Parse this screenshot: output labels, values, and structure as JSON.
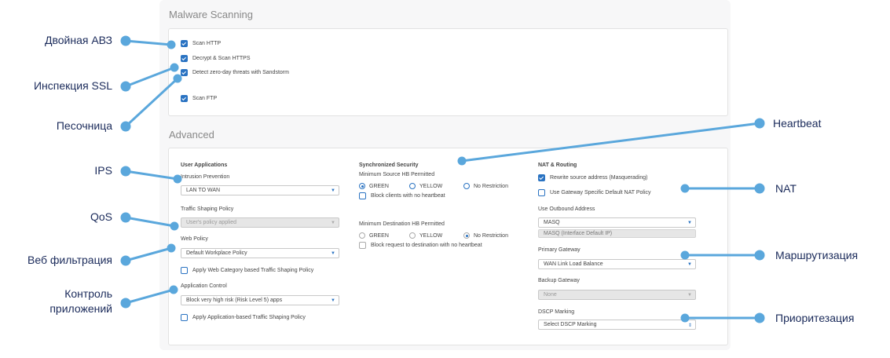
{
  "malware": {
    "title": "Malware Scanning",
    "options": [
      {
        "label": "Scan HTTP",
        "checked": true
      },
      {
        "label": "Decrypt & Scan HTTPS",
        "checked": true
      },
      {
        "label": "Detect zero-day threats with Sandstorm",
        "checked": true
      },
      {
        "label": "Scan FTP",
        "checked": true
      }
    ]
  },
  "advanced": {
    "title": "Advanced",
    "user_apps": {
      "heading": "User Applications",
      "intrusion_label": "Intrusion Prevention",
      "intrusion_value": "LAN TO WAN",
      "traffic_label": "Traffic Shaping Policy",
      "traffic_value": "User's policy applied",
      "web_label": "Web Policy",
      "web_value": "Default Workplace Policy",
      "web_shaping": "Apply Web Category based Traffic Shaping Policy",
      "app_label": "Application Control",
      "app_value": "Block very high risk (Risk Level 5) apps",
      "app_shaping": "Apply Application-based Traffic Shaping Policy"
    },
    "sync": {
      "heading": "Synchronized Security",
      "min_source": "Minimum Source HB Permitted",
      "src_green": "GREEN",
      "src_yellow": "YELLOW",
      "src_none": "No Restriction",
      "block_no_hb": "Block clients with no heartbeat",
      "min_dest": "Minimum Destination HB Permitted",
      "dst_green": "GREEN",
      "dst_yellow": "YELLOW",
      "dst_none": "No Restriction",
      "block_dest": "Block request to destination with no heartbeat"
    },
    "nat": {
      "heading": "NAT & Routing",
      "rewrite": "Rewrite source address (Masquerading)",
      "gateway_nat": "Use Gateway Specific Default NAT Policy",
      "outbound_label": "Use Outbound Address",
      "outbound_value": "MASQ",
      "outbound_sub": "MASQ (Interface Default IP)",
      "primary_label": "Primary Gateway",
      "primary_value": "WAN Link Load Balance",
      "backup_label": "Backup Gateway",
      "backup_value": "None",
      "dscp_label": "DSCP Marking",
      "dscp_value": "Select DSCP Marking"
    }
  },
  "annotations": {
    "av": "Двойная АВЗ",
    "ssl": "Инспекция SSL",
    "sandbox": "Песочница",
    "ips": "IPS",
    "qos": "QoS",
    "web": "Веб фильтрация",
    "app1": "Контроль",
    "app2": "приложений",
    "heartbeat": "Heartbeat",
    "nat": "NAT",
    "routing": "Маршрутизация",
    "priority": "Приоритезация"
  },
  "colors": {
    "accent": "#2a73c2",
    "callout": "#5aa7dc",
    "annotation_text": "#1a2a5a"
  }
}
